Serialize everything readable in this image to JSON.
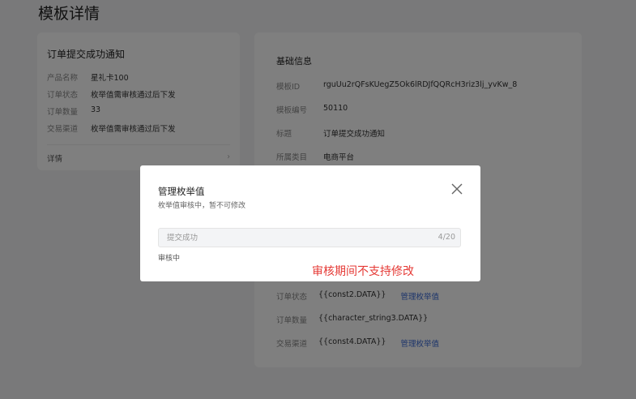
{
  "page": {
    "title": "模板详情"
  },
  "left_card": {
    "title": "订单提交成功通知",
    "rows": [
      {
        "key": "产品名称",
        "value": "星礼卡100"
      },
      {
        "key": "订单状态",
        "value": "枚举值需审核通过后下发"
      },
      {
        "key": "订单数量",
        "value": "33"
      },
      {
        "key": "交易渠道",
        "value": "枚举值需审核通过后下发"
      }
    ],
    "detail_label": "详情",
    "detail_arrow": "›"
  },
  "right_card": {
    "section_title": "基础信息",
    "rows": [
      {
        "key": "模板ID",
        "value": "rguUu2rQFsKUegZ5Ok6lRDJfQQRcH3riz3lj_yvKw_8"
      },
      {
        "key": "模板编号",
        "value": "50110"
      },
      {
        "key": "标题",
        "value": "订单提交成功通知"
      },
      {
        "key": "所属类目",
        "value": "电商平台"
      }
    ],
    "content_rows": [
      {
        "key": "订单状态",
        "value": "{{const2.DATA}}",
        "link": "管理枚举值"
      },
      {
        "key": "订单数量",
        "value": "{{character_string3.DATA}}",
        "link": ""
      },
      {
        "key": "交易渠道",
        "value": "{{const4.DATA}}",
        "link": "管理枚举值"
      }
    ]
  },
  "modal": {
    "title": "管理枚举值",
    "subtitle": "枚举值审核中，暂不可修改",
    "input_value": "提交成功",
    "counter": "4/20",
    "status": "审核中",
    "note": "审核期间不支持修改"
  },
  "colors": {
    "link": "#3a6ad6",
    "note": "#e53935"
  },
  "icons": {
    "close": "close-icon",
    "chevron": "chevron-right-icon"
  }
}
